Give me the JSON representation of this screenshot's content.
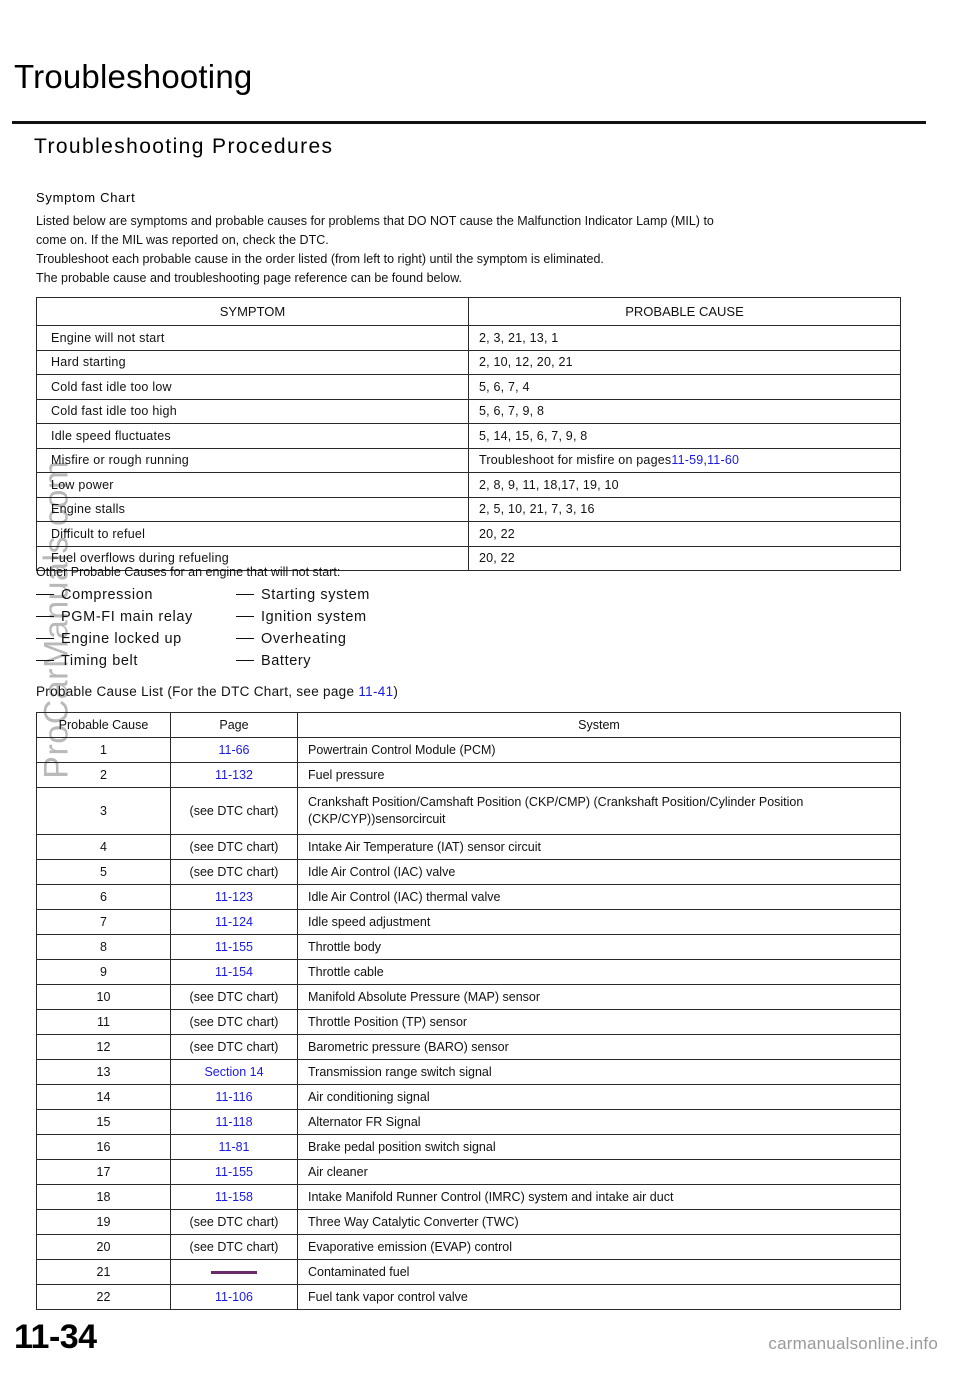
{
  "header": {
    "page_title": "Troubleshooting",
    "section_title": "Troubleshooting  Procedures"
  },
  "intro": {
    "heading": "Symptom Chart",
    "lines": [
      "Listed below are symptoms and probable causes for problems that DO NOT cause the Malfunction Indicator Lamp (MIL) to",
      "come on. If the MIL was reported on, check the DTC.",
      "Troubleshoot each probable cause in the order listed (from left to right) until the symptom is eliminated.",
      "The probable cause and troubleshooting page reference can be found below."
    ]
  },
  "symptom_table": {
    "columns": [
      "SYMPTOM",
      "PROBABLE CAUSE"
    ],
    "rows": [
      {
        "symptom": "Engine will not start",
        "cause": "2, 3, 21, 13, 1",
        "cause_prefix": null,
        "links": []
      },
      {
        "symptom": "Hard  starting",
        "cause": "2, 10, 12, 20, 21",
        "cause_prefix": null,
        "links": []
      },
      {
        "symptom": "Cold  fast  idle  too  low",
        "cause": "5, 6, 7, 4",
        "cause_prefix": null,
        "links": []
      },
      {
        "symptom": "Cold  fast  idle  too  high",
        "cause": "5, 6, 7, 9, 8",
        "cause_prefix": null,
        "links": []
      },
      {
        "symptom": "Idle speed fluctuates",
        "cause": "5, 14, 15, 6, 7, 9, 8",
        "cause_prefix": null,
        "links": []
      },
      {
        "symptom": "Misfire  or  rough  running",
        "cause": null,
        "cause_prefix": "Troubleshoot  for  misfire  on  pages",
        "links": [
          "11-59",
          "11-60"
        ]
      },
      {
        "symptom": "Low  power",
        "cause": "2, 8, 9, 11, 18,17, 19, 10",
        "cause_prefix": null,
        "links": []
      },
      {
        "symptom": "Engine stalls",
        "cause": "2, 5, 10, 21, 7, 3, 16",
        "cause_prefix": null,
        "links": []
      },
      {
        "symptom": "Difficult to refuel",
        "cause": "20, 22",
        "cause_prefix": null,
        "links": []
      },
      {
        "symptom": "Fuel  overflows during  refueling",
        "cause": "20, 22",
        "cause_prefix": null,
        "links": []
      }
    ]
  },
  "other_causes": {
    "heading": "Other Probable Causes for an engine that will not start:",
    "items_left": [
      "Compression",
      "PGM-FI  main  relay",
      "Engine  locked  up",
      "Timing  belt"
    ],
    "items_right": [
      "Starting system",
      "Ignition system",
      "Overheating",
      "Battery"
    ]
  },
  "cause_list": {
    "heading_before": "Probable Cause List (For the DTC Chart, see page ",
    "heading_link": "11-41",
    "heading_after": ")",
    "columns": [
      "Probable Cause",
      "Page",
      "System"
    ],
    "rows": [
      {
        "num": "1",
        "page": "11-66",
        "page_is_link": true,
        "system": "Powertrain Control Module (PCM)"
      },
      {
        "num": "2",
        "page": "11-132",
        "page_is_link": true,
        "system": "Fuel pressure"
      },
      {
        "num": "3",
        "page": "(see DTC chart)",
        "page_is_link": false,
        "system": "Crankshaft  Position/Camshaft Position  (CKP/CMP)  (Crankshaft Position/Cylinder Position (CKP/CYP))sensorcircuit",
        "tall": true
      },
      {
        "num": "4",
        "page": "(see DTC chart)",
        "page_is_link": false,
        "system": "Intake Air Temperature (IAT) sensor circuit"
      },
      {
        "num": "5",
        "page": "(see DTC chart)",
        "page_is_link": false,
        "system": "Idle Air Control (IAC) valve"
      },
      {
        "num": "6",
        "page": "11-123",
        "page_is_link": true,
        "system": "Idle Air Control (IAC) thermal valve"
      },
      {
        "num": "7",
        "page": "11-124",
        "page_is_link": true,
        "system": "Idle  speed adjustment"
      },
      {
        "num": "8",
        "page": "11-155",
        "page_is_link": true,
        "system": "Throttle  body"
      },
      {
        "num": "9",
        "page": "11-154",
        "page_is_link": true,
        "system": "Throttle cable"
      },
      {
        "num": "10",
        "page": "(see DTC chart)",
        "page_is_link": false,
        "system": "Manifold Absolute  Pressure  (MAP)  sensor"
      },
      {
        "num": "11",
        "page": "(see DTC chart)",
        "page_is_link": false,
        "system": "Throttle Position (TP) sensor"
      },
      {
        "num": "12",
        "page": "(see DTC chart)",
        "page_is_link": false,
        "system": "Barometric pressure (BARO) sensor"
      },
      {
        "num": "13",
        "page": "Section 14",
        "page_is_link": true,
        "system": "Transmission range switch signal"
      },
      {
        "num": "14",
        "page": "11-116",
        "page_is_link": true,
        "system": "Air  conditioning  signal"
      },
      {
        "num": "15",
        "page": "11-118",
        "page_is_link": true,
        "system": "Alternator FR Signal"
      },
      {
        "num": "16",
        "page": "11-81",
        "page_is_link": true,
        "system": "Brake pedal position switch signal"
      },
      {
        "num": "17",
        "page": "11-155",
        "page_is_link": true,
        "system": "Air cleaner"
      },
      {
        "num": "18",
        "page": "11-158",
        "page_is_link": true,
        "system": "Intake Manifold Runner Control (IMRC) system and intake air duct"
      },
      {
        "num": "19",
        "page": "(see DTC chart)",
        "page_is_link": false,
        "system": "Three Way Catalytic Converter (TWC)"
      },
      {
        "num": "20",
        "page": "(see DTC chart)",
        "page_is_link": false,
        "system": "Evaporative emission (EVAP) control"
      },
      {
        "num": "21",
        "page": "",
        "page_is_link": false,
        "page_is_dash": true,
        "system": "Contaminated fuel"
      },
      {
        "num": "22",
        "page": "11-106",
        "page_is_link": true,
        "system": "Fuel tank vapor control valve"
      }
    ]
  },
  "footer": {
    "folio": "11-34",
    "site_credit": "carmanualsonline.info"
  },
  "watermark": {
    "text": "ProCarManuals.com"
  },
  "colors": {
    "link_blue": "#1a1ae6",
    "dash_purple": "#6a2b6a",
    "watermark_gray": "#b9b9b9",
    "credit_gray": "#9a9a9a"
  }
}
